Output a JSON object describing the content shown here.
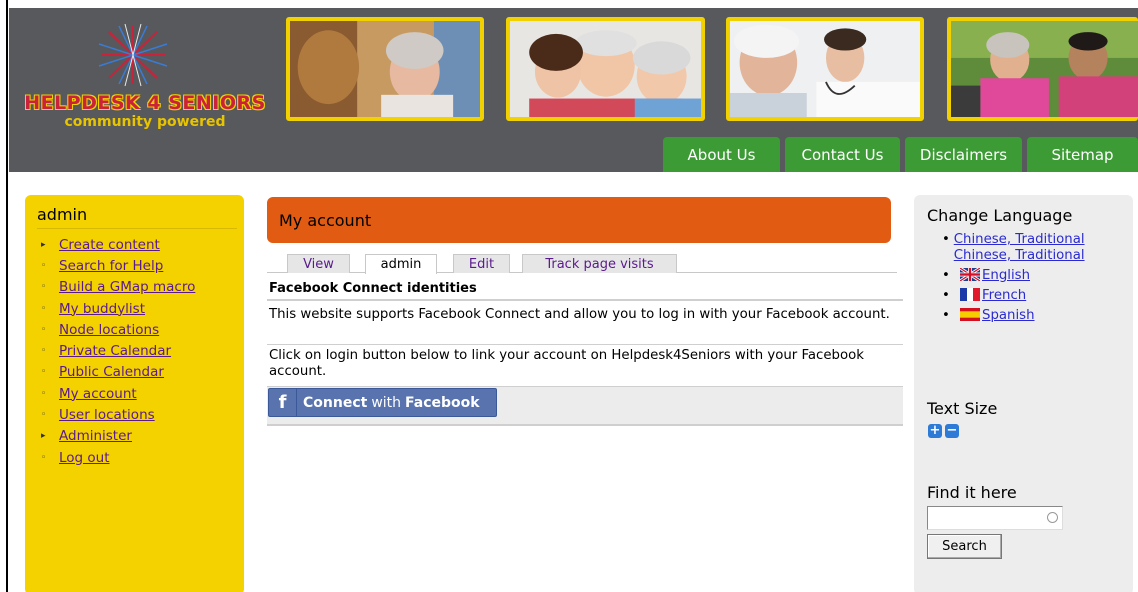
{
  "site": {
    "logo_title": "HELPDESK 4 SENIORS",
    "logo_subtitle": "community powered"
  },
  "nav": {
    "about": "About Us",
    "contact": "Contact Us",
    "disclaimers": "Disclaimers",
    "sitemap": "Sitemap"
  },
  "left_sidebar": {
    "heading": "admin",
    "items": [
      {
        "label": "Create content",
        "bullet": "▸"
      },
      {
        "label": "Search for Help",
        "bullet": "◦"
      },
      {
        "label": "Build a GMap macro",
        "bullet": "◦"
      },
      {
        "label": "My buddylist",
        "bullet": "◦"
      },
      {
        "label": "Node locations",
        "bullet": "◦"
      },
      {
        "label": "Private Calendar",
        "bullet": "◦"
      },
      {
        "label": "Public Calendar",
        "bullet": "◦"
      },
      {
        "label": "My account",
        "bullet": "◦"
      },
      {
        "label": "User locations",
        "bullet": "◦"
      },
      {
        "label": "Administer",
        "bullet": "▸"
      },
      {
        "label": "Log out",
        "bullet": "◦"
      }
    ]
  },
  "main": {
    "title": "My account",
    "tabs": [
      {
        "label": "View"
      },
      {
        "label": "admin"
      },
      {
        "label": "Edit"
      },
      {
        "label": "Track page visits"
      }
    ],
    "section_heading": "Facebook Connect identities",
    "paragraph1": "This website supports Facebook Connect and allow you to log in with your Facebook account.",
    "paragraph2": "Click on login button below to link your account on Helpdesk4Seniors with your Facebook account.",
    "fb_button": {
      "icon": "f",
      "prefix": "Connect",
      "mid": "with",
      "brand": "Facebook"
    }
  },
  "right_sidebar": {
    "language_heading": "Change Language",
    "languages": [
      {
        "label": "Chinese, Traditional",
        "label2": "Chinese, Traditional"
      },
      {
        "label": "English"
      },
      {
        "label": "French"
      },
      {
        "label": "Spanish"
      }
    ],
    "text_size_heading": "Text Size",
    "size_plus": "+",
    "size_minus": "−",
    "find_heading": "Find it here",
    "search_value": "",
    "search_button": "Search"
  },
  "colors": {
    "header_bg": "#57595c",
    "nav_green": "#3d9b35",
    "sidebar_yellow": "#f4d200",
    "title_orange": "#e15b12",
    "facebook_blue": "#5873ad"
  }
}
